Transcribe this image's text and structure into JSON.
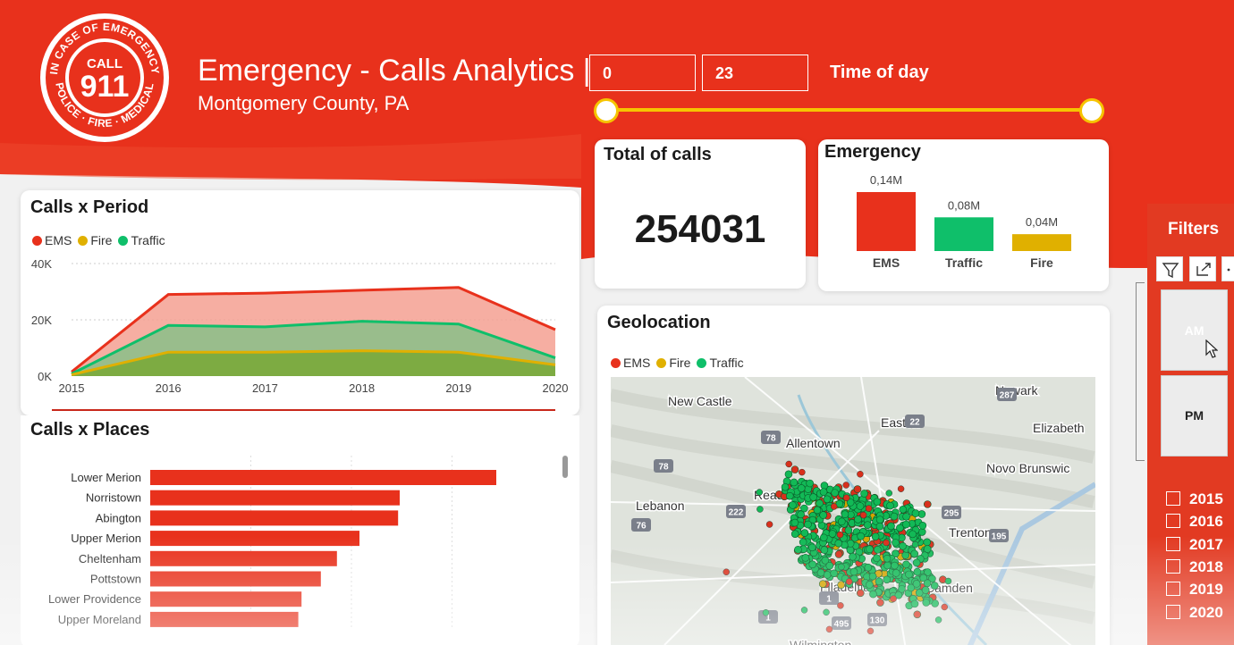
{
  "header": {
    "title": "Emergency - Calls Analytics |",
    "subtitle": "Montgomery County, PA",
    "time_from": "0",
    "time_to": "23",
    "time_label": "Time of day",
    "slider": {
      "min": 0,
      "max": 23,
      "from": 0,
      "to": 23
    },
    "brand_color": "#e8311c",
    "accent_color": "#f6c400"
  },
  "logo": {
    "top_text": "IN CASE OF EMERGENCY",
    "bottom_text": "POLICE · FIRE · MEDICAL",
    "call": "CALL",
    "number": "911"
  },
  "total_card": {
    "title": "Total of calls",
    "value": "254031"
  },
  "emergency_card": {
    "title": "Emergency",
    "bars": [
      {
        "label": "EMS",
        "value": 0.14,
        "text": "0,14M",
        "color": "#e8311c"
      },
      {
        "label": "Traffic",
        "value": 0.08,
        "text": "0,08M",
        "color": "#0fbf6a"
      },
      {
        "label": "Fire",
        "value": 0.04,
        "text": "0,04M",
        "color": "#e0b000"
      }
    ]
  },
  "period_card": {
    "title": "Calls x Period",
    "legend": [
      {
        "name": "EMS",
        "color": "#e8311c"
      },
      {
        "name": "Fire",
        "color": "#e0b000"
      },
      {
        "name": "Traffic",
        "color": "#0fbf6a"
      }
    ]
  },
  "places_card": {
    "title": "Calls x Places"
  },
  "geo_card": {
    "title": "Geolocation",
    "legend": [
      {
        "name": "EMS",
        "color": "#e8311c"
      },
      {
        "name": "Fire",
        "color": "#e0b000"
      },
      {
        "name": "Traffic",
        "color": "#0fbf6a"
      }
    ],
    "map_labels": [
      "New Castle",
      "Newark",
      "Easton",
      "Elizabeth",
      "Allentown",
      "Novo Brunswic",
      "Reading",
      "Lebanon",
      "Trenton",
      "Filadelfia",
      "Camden",
      "Wilmington"
    ],
    "road_numbers": [
      "287",
      "22",
      "78",
      "78",
      "76",
      "222",
      "295",
      "195",
      "1",
      "1",
      "495",
      "130"
    ]
  },
  "filters": {
    "title": "Filters",
    "tiles": [
      "AM",
      "PM"
    ],
    "years": [
      "2015",
      "2016",
      "2017",
      "2018",
      "2019",
      "2020"
    ]
  },
  "chart_data": [
    {
      "type": "area",
      "x": [
        2015,
        2016,
        2017,
        2018,
        2019,
        2020
      ],
      "series": [
        {
          "name": "EMS",
          "values": [
            1500,
            29000,
            29500,
            30500,
            31500,
            16500
          ]
        },
        {
          "name": "Traffic",
          "values": [
            800,
            18000,
            17500,
            19500,
            18500,
            6500
          ]
        },
        {
          "name": "Fire",
          "values": [
            500,
            8500,
            8500,
            9000,
            8500,
            4000
          ]
        }
      ],
      "x_ticks": [
        "2015",
        "2016",
        "2017",
        "2018",
        "2019",
        "2020"
      ],
      "y_ticks": [
        "0K",
        "20K",
        "40K"
      ],
      "ylim": [
        0,
        40000
      ],
      "legend": "top-left"
    },
    {
      "type": "bar",
      "orientation": "horizontal",
      "categories": [
        "Lower Merion",
        "Norristown",
        "Abington",
        "Upper Merion",
        "Cheltenham",
        "Pottstown",
        "Lower Providence",
        "Upper Moreland"
      ],
      "values": [
        21500,
        15500,
        15400,
        13000,
        11600,
        10600,
        9400,
        9200
      ],
      "xlim": [
        0,
        25000
      ]
    }
  ]
}
